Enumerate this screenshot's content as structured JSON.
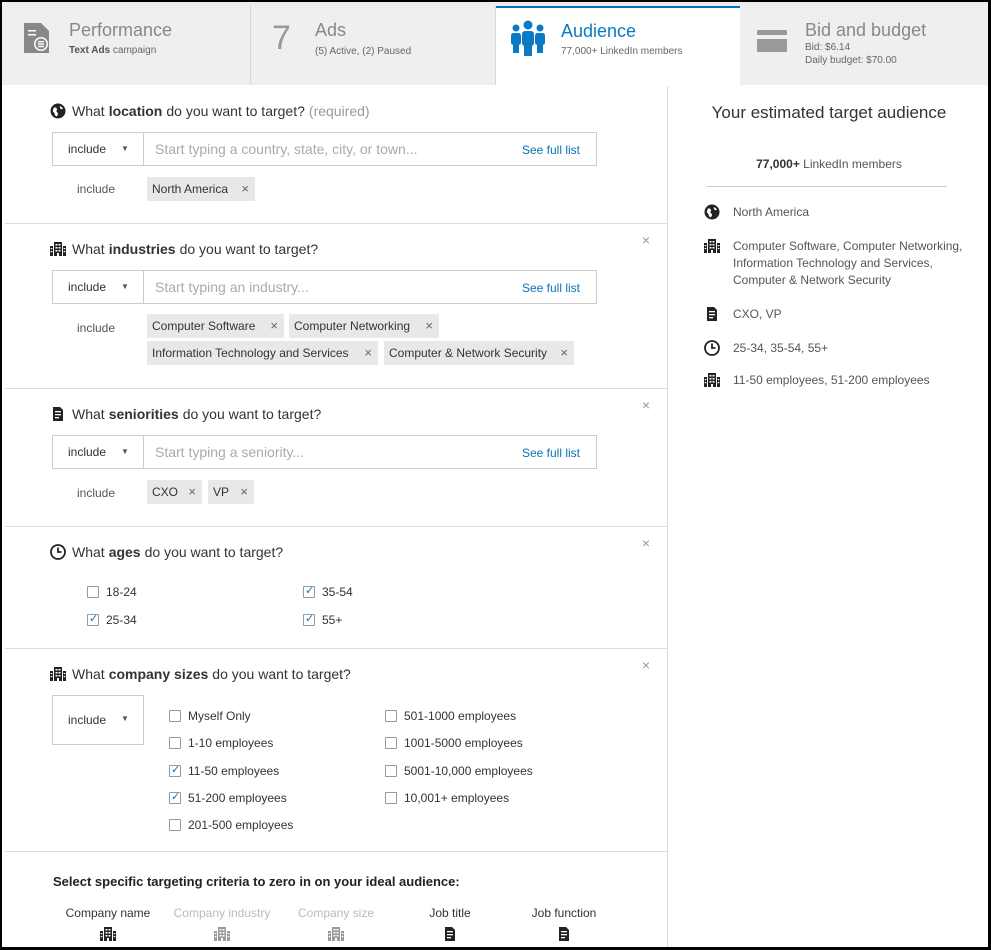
{
  "tabs": [
    {
      "title": "Performance",
      "sub_bold": "Text Ads",
      "sub": "campaign",
      "icon": "document-chart-icon"
    },
    {
      "number": "7",
      "title": "Ads",
      "sub": "(5) Active,  (2) Paused"
    },
    {
      "title": "Audience",
      "sub": "77,000+ LinkedIn members",
      "icon": "people-group-icon"
    },
    {
      "title": "Bid and budget",
      "sub_line1": "Bid:  $6.14",
      "sub_line2": "Daily budget:  $70.00",
      "icon": "credit-card-icon"
    }
  ],
  "location": {
    "q_pre": "What",
    "q_bold": "location",
    "q_post": "do you want to target?",
    "required": "(required)",
    "include": "include",
    "placeholder": "Start typing a country, state, city, or town...",
    "see_full": "See full list",
    "inc_label": "include",
    "chips": [
      "North America"
    ]
  },
  "industries": {
    "q_pre": "What",
    "q_bold": "industries",
    "q_post": "do you want to target?",
    "include": "include",
    "placeholder": "Start typing an industry...",
    "see_full": "See full list",
    "inc_label": "include",
    "chips": [
      "Computer Software",
      "Computer Networking",
      "Information Technology and Services",
      "Computer & Network Security"
    ]
  },
  "seniorities": {
    "q_pre": "What",
    "q_bold": "seniorities",
    "q_post": "do you want to target?",
    "include": "include",
    "placeholder": "Start typing a seniority...",
    "see_full": "See full list",
    "inc_label": "include",
    "chips": [
      "CXO",
      "VP"
    ]
  },
  "ages": {
    "q_pre": "What",
    "q_bold": "ages",
    "q_post": "do you want to target?",
    "options": [
      {
        "label": "18-24",
        "checked": false
      },
      {
        "label": "25-34",
        "checked": true
      },
      {
        "label": "35-54",
        "checked": true
      },
      {
        "label": "55+",
        "checked": true
      }
    ]
  },
  "company_sizes": {
    "q_pre": "What",
    "q_bold": "company sizes",
    "q_post": "do you want to target?",
    "include": "include",
    "options": [
      {
        "label": "Myself Only",
        "checked": false
      },
      {
        "label": "1-10 employees",
        "checked": false
      },
      {
        "label": "11-50 employees",
        "checked": true
      },
      {
        "label": "51-200 employees",
        "checked": true
      },
      {
        "label": "201-500 employees",
        "checked": false
      },
      {
        "label": "501-1000 employees",
        "checked": false
      },
      {
        "label": "1001-5000 employees",
        "checked": false
      },
      {
        "label": "5001-10,000 employees",
        "checked": false
      },
      {
        "label": "10,001+ employees",
        "checked": false
      }
    ]
  },
  "criteria": {
    "title": "Select specific targeting criteria to zero in on your ideal audience:",
    "items": [
      {
        "label": "Company name",
        "enabled": true
      },
      {
        "label": "Company industry",
        "enabled": false
      },
      {
        "label": "Company size",
        "enabled": false
      },
      {
        "label": "Job title",
        "enabled": true
      },
      {
        "label": "Job function",
        "enabled": true
      }
    ]
  },
  "summary": {
    "heading": "Your estimated target audience",
    "count_bold": "77,000+",
    "count_rest": "LinkedIn members",
    "rows": [
      {
        "icon": "globe-icon",
        "text": "North America"
      },
      {
        "icon": "building-icon",
        "text": "Computer Software, Computer Networking, Information Technology and Services, Computer & Network Security"
      },
      {
        "icon": "badge-icon",
        "text": "CXO, VP"
      },
      {
        "icon": "clock-icon",
        "text": "25-34, 35-54, 55+"
      },
      {
        "icon": "building-icon",
        "text": "11-50 employees, 51-200 employees"
      }
    ]
  },
  "close_glyph": "×",
  "colors": {
    "accent": "#0a73b8",
    "tab_bg": "#efefef",
    "chip_bg": "#e8e8e8"
  }
}
